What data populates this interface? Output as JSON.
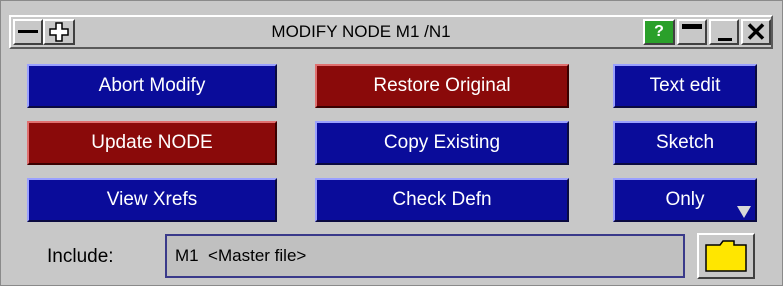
{
  "window": {
    "title": "MODIFY NODE M1 /N1",
    "help_label": "?",
    "close_label": "✕"
  },
  "buttons": {
    "abort_modify": "Abort Modify",
    "restore_original": "Restore Original",
    "text_edit": "Text edit",
    "update_node": "Update NODE",
    "copy_existing": "Copy Existing",
    "sketch": "Sketch",
    "view_xrefs": "View Xrefs",
    "check_defn": "Check Defn",
    "only": "Only"
  },
  "include": {
    "label": "Include:",
    "value": "M1  <Master file>"
  },
  "colors": {
    "blue_button": "#0a0c9a",
    "red_button": "#8a0a0a",
    "help_green": "#2aa02a",
    "folder_yellow": "#ffe600"
  },
  "icons": {
    "move": "move-cross-icon",
    "folder": "folder-icon"
  }
}
